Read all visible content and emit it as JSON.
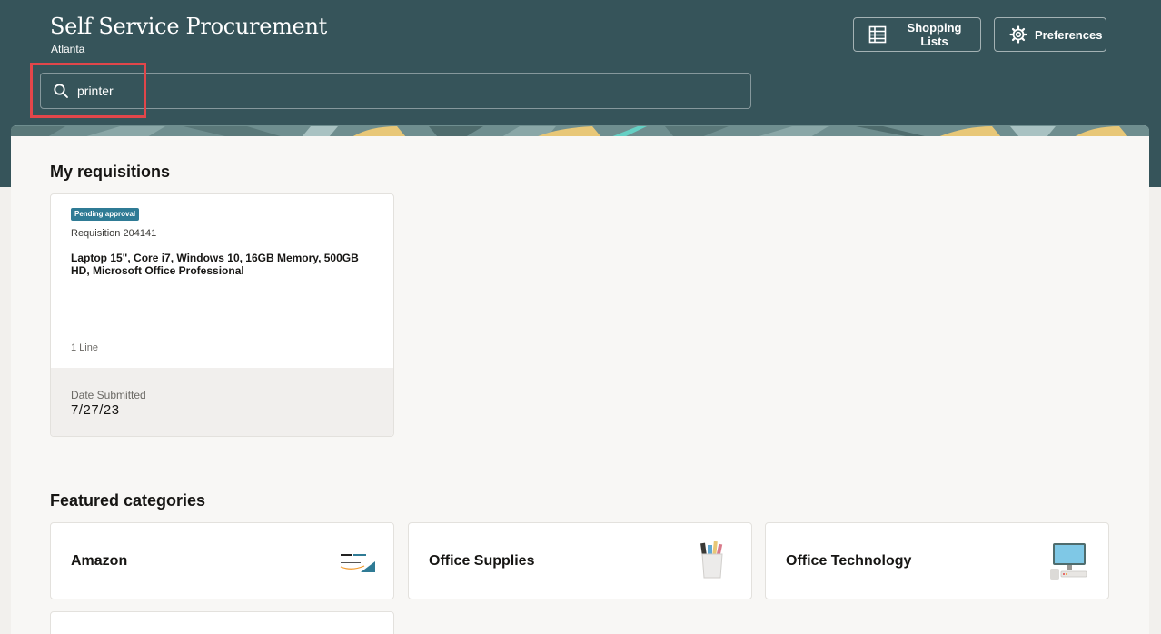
{
  "header": {
    "title": "Self Service Procurement",
    "subtitle": "Atlanta",
    "shopping_lists_label": "Shopping Lists",
    "preferences_label": "Preferences"
  },
  "search": {
    "value": "printer"
  },
  "requisitions": {
    "section_title": "My requisitions",
    "items": [
      {
        "status": "Pending approval",
        "number": "Requisition 204141",
        "description": "Laptop 15\", Core i7, Windows 10, 16GB Memory, 500GB HD, Microsoft Office Professional",
        "lines": "1 Line",
        "date_label": "Date Submitted",
        "date_value": "7/27/23"
      }
    ]
  },
  "categories": {
    "section_title": "Featured categories",
    "items": [
      {
        "label": "Amazon",
        "icon": "amazon-business-logo"
      },
      {
        "label": "Office Supplies",
        "icon": "pencil-cup-icon"
      },
      {
        "label": "Office Technology",
        "icon": "desktop-computer-icon"
      }
    ]
  },
  "colors": {
    "header_bg": "#36545a",
    "badge_bg": "#2f7b95",
    "highlight": "#e2464a"
  }
}
